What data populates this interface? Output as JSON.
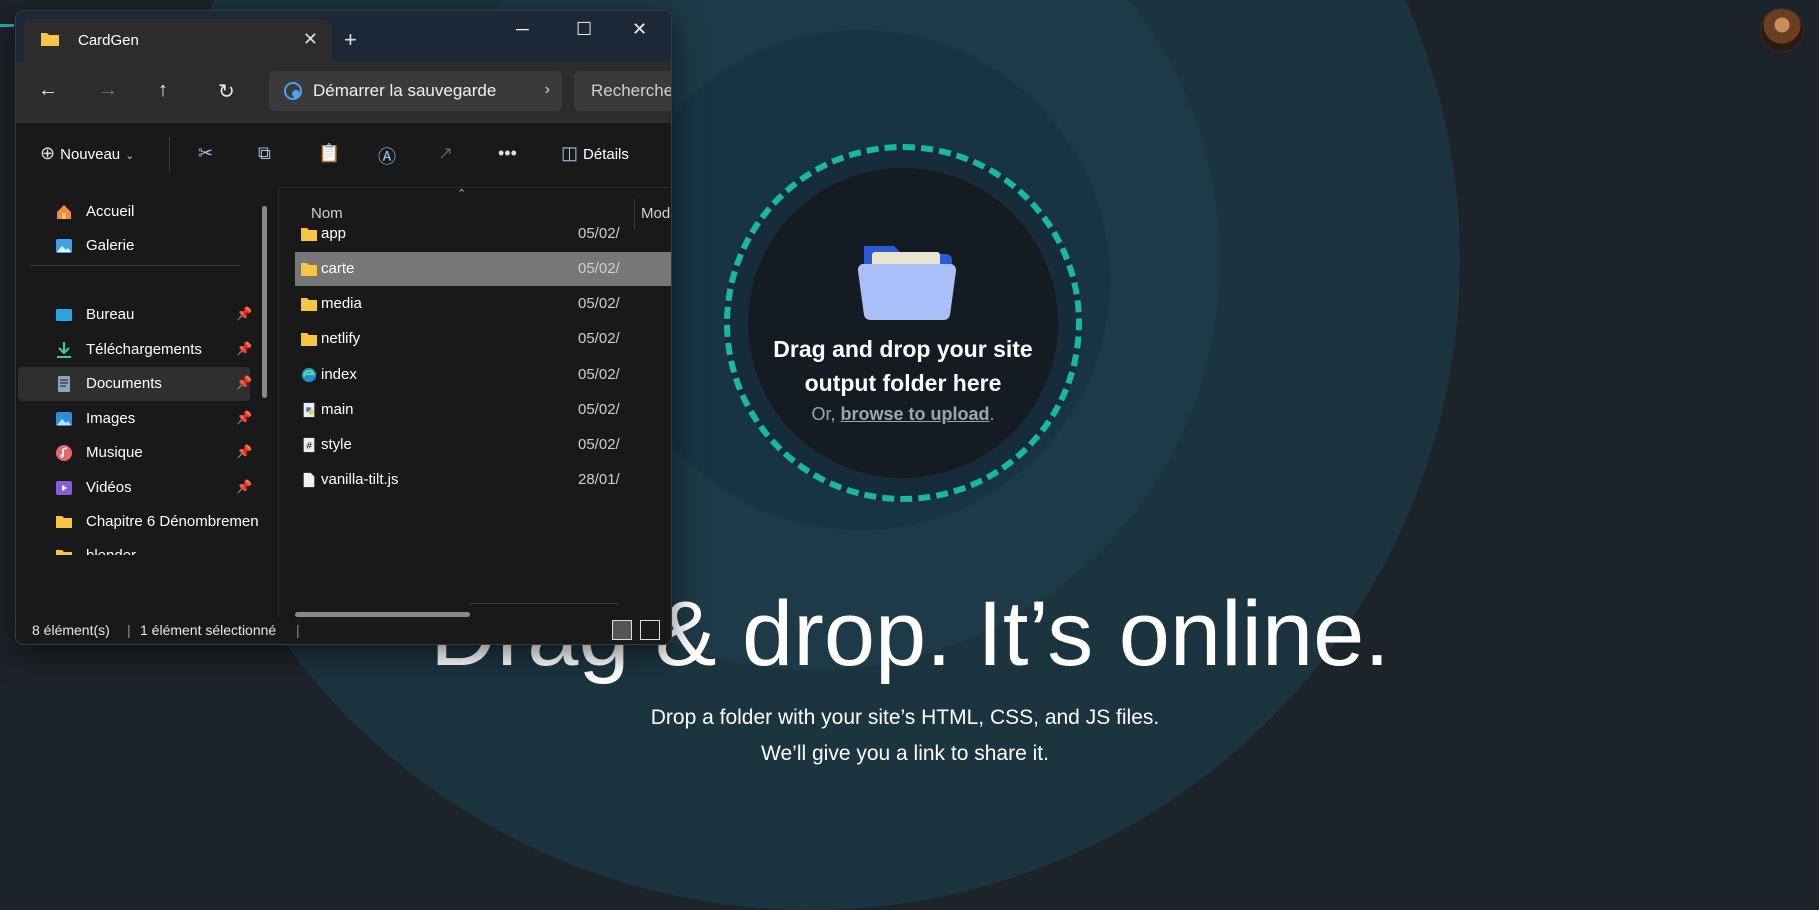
{
  "page": {
    "hero_title": "Drag & drop. It’s online.",
    "hero_sub_line1": "Drop a folder with your site’s HTML, CSS, and JS files.",
    "hero_sub_line2": "We’ll give you a link to share it.",
    "dropzone": {
      "title_line1": "Drag and drop your site",
      "title_line2": "output folder here",
      "or_text": "Or, ",
      "link_text": "browse to upload",
      "period": "."
    },
    "accent_color": "#19b7a4"
  },
  "explorer": {
    "tab_title": "CardGen",
    "new_tab": "+",
    "window_buttons": {
      "minimize": "─",
      "maximize": "☐",
      "close": "✕"
    },
    "address_text": "Démarrer la sauvegarde",
    "search_placeholder": "Rechercher d",
    "toolbar": {
      "new_label": "Nouveau",
      "details_label": "Détails"
    },
    "sidebar": {
      "items": [
        {
          "label": "Accueil",
          "icon": "home-icon",
          "pinned": false
        },
        {
          "label": "Galerie",
          "icon": "gallery-icon",
          "pinned": false
        },
        {
          "label": "Bureau",
          "icon": "desktop-icon",
          "pinned": true
        },
        {
          "label": "Téléchargements",
          "icon": "download-icon",
          "pinned": true
        },
        {
          "label": "Documents",
          "icon": "documents-icon",
          "pinned": true
        },
        {
          "label": "Images",
          "icon": "pictures-icon",
          "pinned": true
        },
        {
          "label": "Musique",
          "icon": "music-icon",
          "pinned": true
        },
        {
          "label": "Vidéos",
          "icon": "videos-icon",
          "pinned": true
        },
        {
          "label": "Chapitre 6 Dénombremen",
          "icon": "folder-icon",
          "pinned": false
        },
        {
          "label": "blender",
          "icon": "folder-icon",
          "pinned": false
        }
      ]
    },
    "columns": {
      "name": "Nom",
      "modified": "Modifi"
    },
    "files": [
      {
        "name": "app",
        "date": "05/02/",
        "icon": "folder-icon"
      },
      {
        "name": "carte",
        "date": "05/02/",
        "icon": "folder-icon"
      },
      {
        "name": "media",
        "date": "05/02/",
        "icon": "folder-icon"
      },
      {
        "name": "netlify",
        "date": "05/02/",
        "icon": "folder-icon"
      },
      {
        "name": "index",
        "date": "05/02/",
        "icon": "edge-html-icon"
      },
      {
        "name": "main",
        "date": "05/02/",
        "icon": "python-file-icon"
      },
      {
        "name": "style",
        "date": "05/02/",
        "icon": "css-file-icon"
      },
      {
        "name": "vanilla-tilt.js",
        "date": "28/01/",
        "icon": "file-icon"
      }
    ],
    "status": {
      "count": "8 élément(s)",
      "selected": "1 élément sélectionné"
    }
  }
}
